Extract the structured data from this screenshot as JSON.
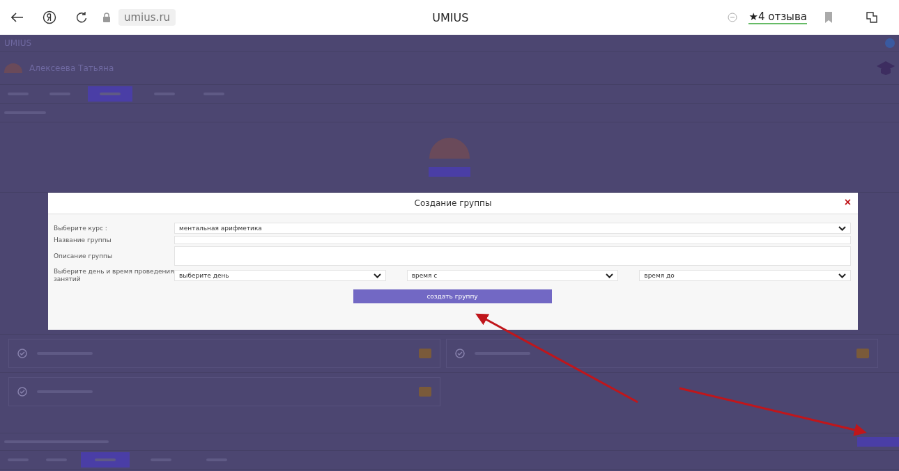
{
  "browser": {
    "address": "umius.ru",
    "title": "UMIUS",
    "reviews": "★4 отзыва"
  },
  "page": {
    "brand": "UMIUS",
    "user_name": "Алексеева Татьяна",
    "tabs": [
      {
        "selected": false
      },
      {
        "selected": false
      },
      {
        "selected": true
      },
      {
        "selected": false
      },
      {
        "selected": false
      }
    ],
    "bottom_tabs": [
      {
        "selected": false
      },
      {
        "selected": false
      },
      {
        "selected": true
      },
      {
        "selected": false
      },
      {
        "selected": false
      }
    ]
  },
  "modal": {
    "title": "Создание группы",
    "close": "×",
    "fields": [
      {
        "kind": "select",
        "label": "Выберите курс :",
        "value": "ментальная арифметика"
      },
      {
        "kind": "input",
        "label": "Название группы"
      },
      {
        "kind": "textarea",
        "label": "Описание группы"
      },
      {
        "kind": "schedule",
        "label": "Выберите день и время проведения занятий",
        "selects": [
          "выберите день",
          "время с",
          "время до"
        ]
      }
    ],
    "submit": "создать группу"
  }
}
